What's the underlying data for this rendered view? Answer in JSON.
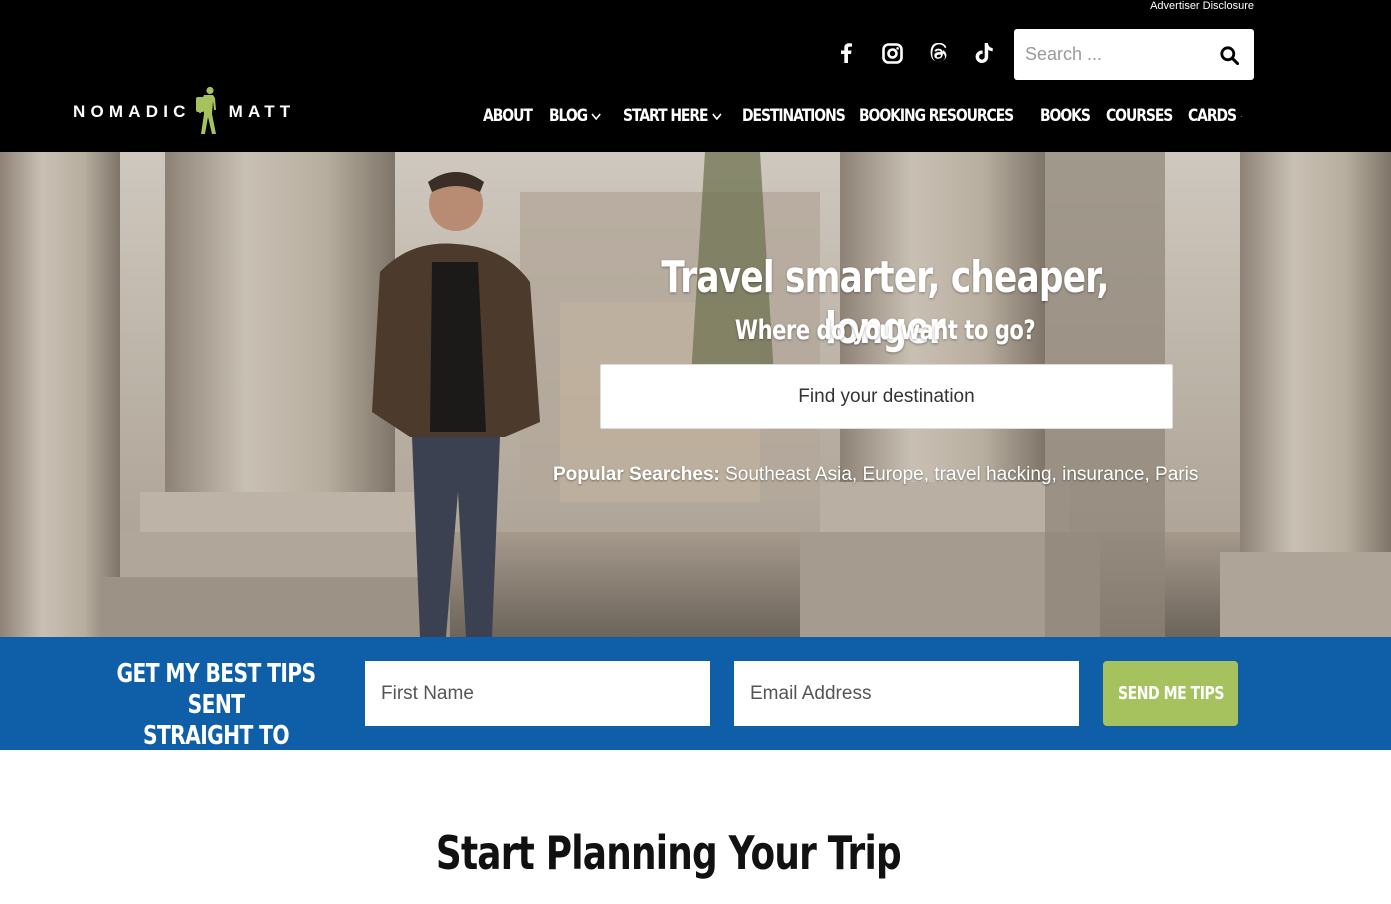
{
  "header": {
    "advertiser_disclosure": "Advertiser Disclosure",
    "social_icons": [
      "facebook-icon",
      "instagram-icon",
      "threads-icon",
      "tiktok-icon"
    ],
    "search": {
      "placeholder": "Search ..."
    },
    "logo": {
      "left_word": "NOMADIC",
      "right_word": "MATT"
    },
    "nav": [
      {
        "label": "ABOUT",
        "dropdown": false
      },
      {
        "label": "BLOG",
        "dropdown": true
      },
      {
        "label": "START HERE",
        "dropdown": true
      },
      {
        "label": "DESTINATIONS",
        "dropdown": false
      },
      {
        "label": "BOOKING RESOURCES",
        "dropdown": true
      },
      {
        "label": "BOOKS",
        "dropdown": false
      },
      {
        "label": "COURSES",
        "dropdown": false
      },
      {
        "label": "CARDS",
        "dropdown": true
      }
    ]
  },
  "hero": {
    "title": "Travel smarter, cheaper, longer",
    "subtitle": "Where do you want to go?",
    "destination_button": "Find your destination",
    "popular_label": "Popular Searches:",
    "popular_items": [
      "Southeast Asia",
      "Europe",
      "travel hacking",
      "insurance",
      "Paris"
    ]
  },
  "signup": {
    "title_line1": "GET MY BEST TIPS SENT",
    "title_line2": "STRAIGHT TO YOU!",
    "first_name_placeholder": "First Name",
    "email_placeholder": "Email Address",
    "button_label": "SEND ME TIPS"
  },
  "section": {
    "heading": "Start Planning Your Trip"
  },
  "colors": {
    "header_bg": "#000000",
    "band_bg": "#0f5fa8",
    "button_green": "#a6c25e",
    "logo_green": "#a6c25e"
  }
}
